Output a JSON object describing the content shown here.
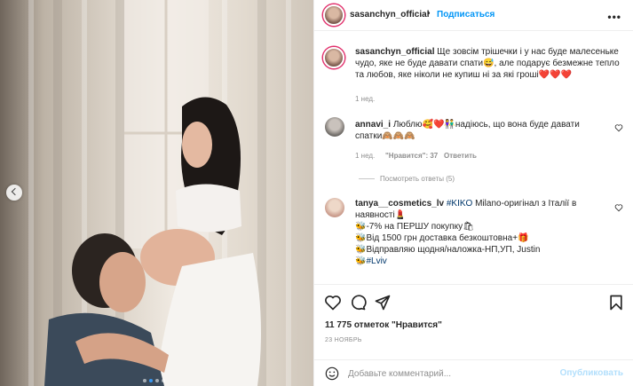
{
  "post": {
    "username": "sasanchyn_official",
    "dot": "•",
    "follow_label": "Подписаться",
    "more_label": "•••"
  },
  "caption": {
    "username": "sasanchyn_official",
    "text_line1": "Ще зовсім трішечки і у нас буде малесеньке",
    "text_line2": "чудо, яке не буде давати спати😅, але подарує безмежне тепло",
    "text_line3": "та любов, яке ніколи не купиш ні за які гроші❤️❤️❤️",
    "time": "1 нед."
  },
  "comments": [
    {
      "username": "annavi_i",
      "text_line1": "Люблю🥰❤️👫надіюсь, що вона буде давати",
      "text_line2": "спатки🙈🙈🙈",
      "time": "1 нед.",
      "likes": "\"Нравится\": 37",
      "reply": "Ответить",
      "view_replies": "Посмотреть ответы (5)"
    },
    {
      "username": "tanya__cosmetics_lv",
      "text_line1_tag": "#KIKO",
      "text_line1_rest": " Milano-оригінал з Італії в",
      "text_line2": "наявності💄",
      "text_line3": "🐝-7% на ПЕРШУ покупку🛍",
      "text_line4": "🐝Від 1500 грн доставка безкоштовна+🎁",
      "text_line5": "🐝Відправляю щодня/наложка-НП,УП, Justin",
      "text_line6": "🐝#Lviv"
    }
  ],
  "likes_text": "11 775 отметок \"Нравится\"",
  "date": "23 НОЯБРЬ",
  "comment_input": {
    "placeholder": "Добавьте комментарий...",
    "publish_label": "Опубликовать"
  },
  "colors": {
    "accent": "#0095f6",
    "publish_disabled": "#b2dffc",
    "heart": "#e0245e"
  }
}
